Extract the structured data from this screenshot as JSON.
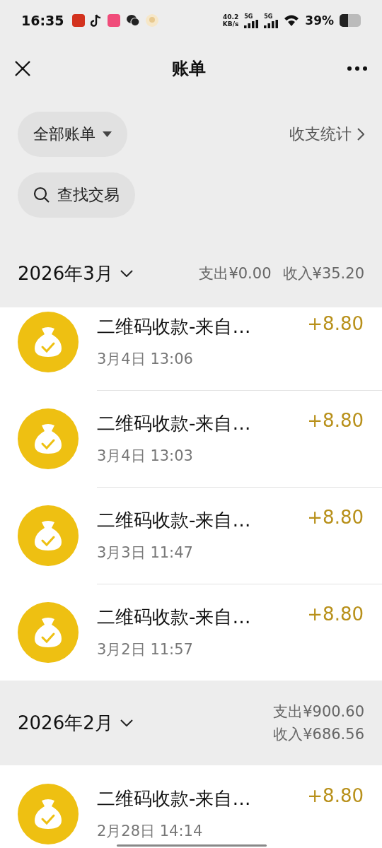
{
  "status_bar": {
    "time": "16:35",
    "speed": "40.2",
    "speed_unit": "KB/s",
    "network_1": "5G",
    "network_2": "5G",
    "battery": "39%"
  },
  "nav": {
    "title": "账单"
  },
  "filters": {
    "dropdown": "全部账单",
    "stats_link": "收支统计",
    "search": "查找交易"
  },
  "months": [
    {
      "title": "2026年3月",
      "expense": "支出¥0.00",
      "income": "收入¥35.20",
      "kind": "inline",
      "items": [
        {
          "title": "二维码收款-来自…",
          "amount": "+8.80",
          "time": "3月4日 13:06"
        },
        {
          "title": "二维码收款-来自…",
          "amount": "+8.80",
          "time": "3月4日 13:03"
        },
        {
          "title": "二维码收款-来自…",
          "amount": "+8.80",
          "time": "3月3日 11:47"
        },
        {
          "title": "二维码收款-来自…",
          "amount": "+8.80",
          "time": "3月2日 11:57"
        }
      ]
    },
    {
      "title": "2026年2月",
      "expense": "支出¥900.60",
      "income": "收入¥686.56",
      "kind": "stacked",
      "items": [
        {
          "title": "二维码收款-来自…",
          "amount": "+8.80",
          "time": "2月28日 14:14"
        }
      ]
    }
  ]
}
